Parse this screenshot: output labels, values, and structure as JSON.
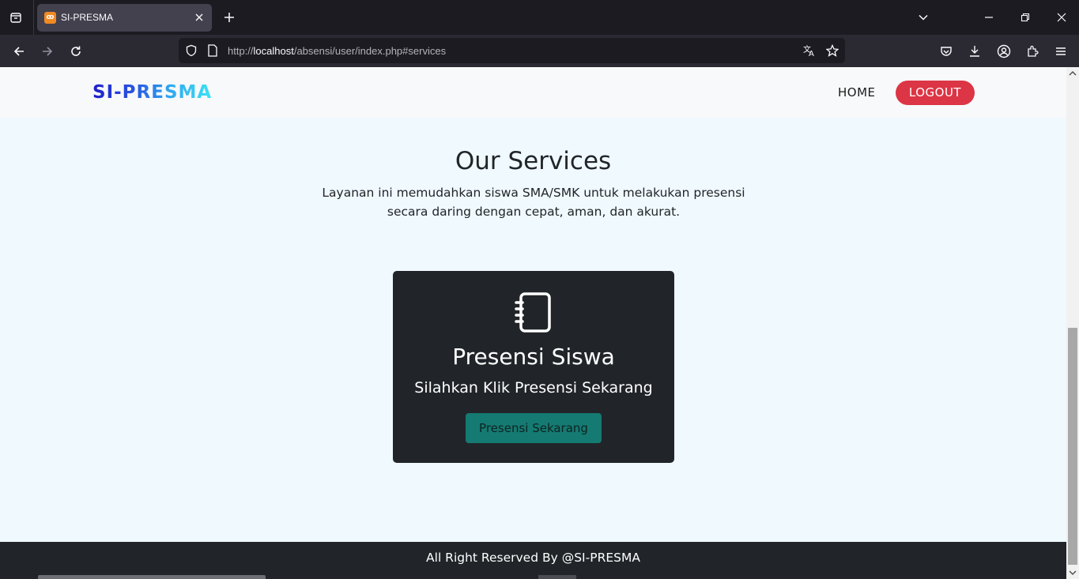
{
  "browser": {
    "tab_title": "SI-PRESMA",
    "tab_favicon": "xampp-icon",
    "url_prefix": "http://",
    "url_host": "localhost",
    "url_path": "/absensi/user/index.php#services"
  },
  "site": {
    "logo": "SI-PRESMA",
    "nav": {
      "home": "HOME",
      "logout": "LOGOUT"
    }
  },
  "services": {
    "title": "Our Services",
    "description": "Layanan ini memudahkan siswa SMA/SMK untuk melakukan presensi secara daring dengan cepat, aman, dan akurat.",
    "card": {
      "icon": "notebook-icon",
      "title": "Presensi Siswa",
      "text": "Silahkan Klik Presensi Sekarang",
      "button": "Presensi Sekarang"
    }
  },
  "footer": {
    "text": "All Right Reserved By @SI-PRESMA"
  },
  "colors": {
    "logout": "#dc3545",
    "card_bg": "#212529",
    "card_button": "#198f86",
    "page_bg": "#f0f9fe"
  }
}
